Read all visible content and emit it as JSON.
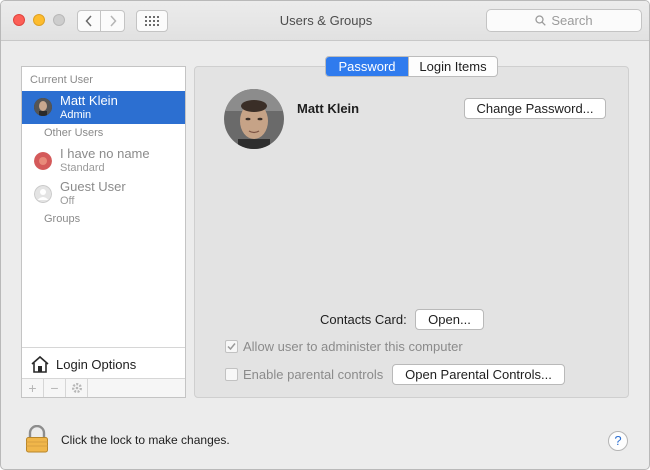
{
  "window": {
    "title": "Users & Groups"
  },
  "search": {
    "placeholder": "Search"
  },
  "tabs": [
    {
      "label": "Password",
      "selected": true
    },
    {
      "label": "Login Items",
      "selected": false
    }
  ],
  "sidebar": {
    "current_user_heading": "Current User",
    "current_user": {
      "name": "Matt Klein",
      "role": "Admin"
    },
    "other_users_heading": "Other Users",
    "other_users": [
      {
        "name": "I have no name",
        "role": "Standard"
      },
      {
        "name": "Guest User",
        "role": "Off"
      }
    ],
    "groups_label": "Groups",
    "login_options_label": "Login Options",
    "tools": {
      "add": "+",
      "remove": "−"
    }
  },
  "detail": {
    "user_name": "Matt Klein",
    "change_password_label": "Change Password...",
    "contacts_card_label": "Contacts Card:",
    "open_label": "Open...",
    "allow_admin_label": "Allow user to administer this computer",
    "allow_admin_checked": true,
    "parental_controls_label": "Enable parental controls",
    "parental_controls_checked": false,
    "open_parental_label": "Open Parental Controls..."
  },
  "footer": {
    "lock_text": "Click the lock to make changes.",
    "help": "?"
  },
  "colors": {
    "selection": "#2c6fd1",
    "tab_active": "#2f7bee",
    "close": "#fc5f57",
    "minimize": "#fdbc2e"
  }
}
